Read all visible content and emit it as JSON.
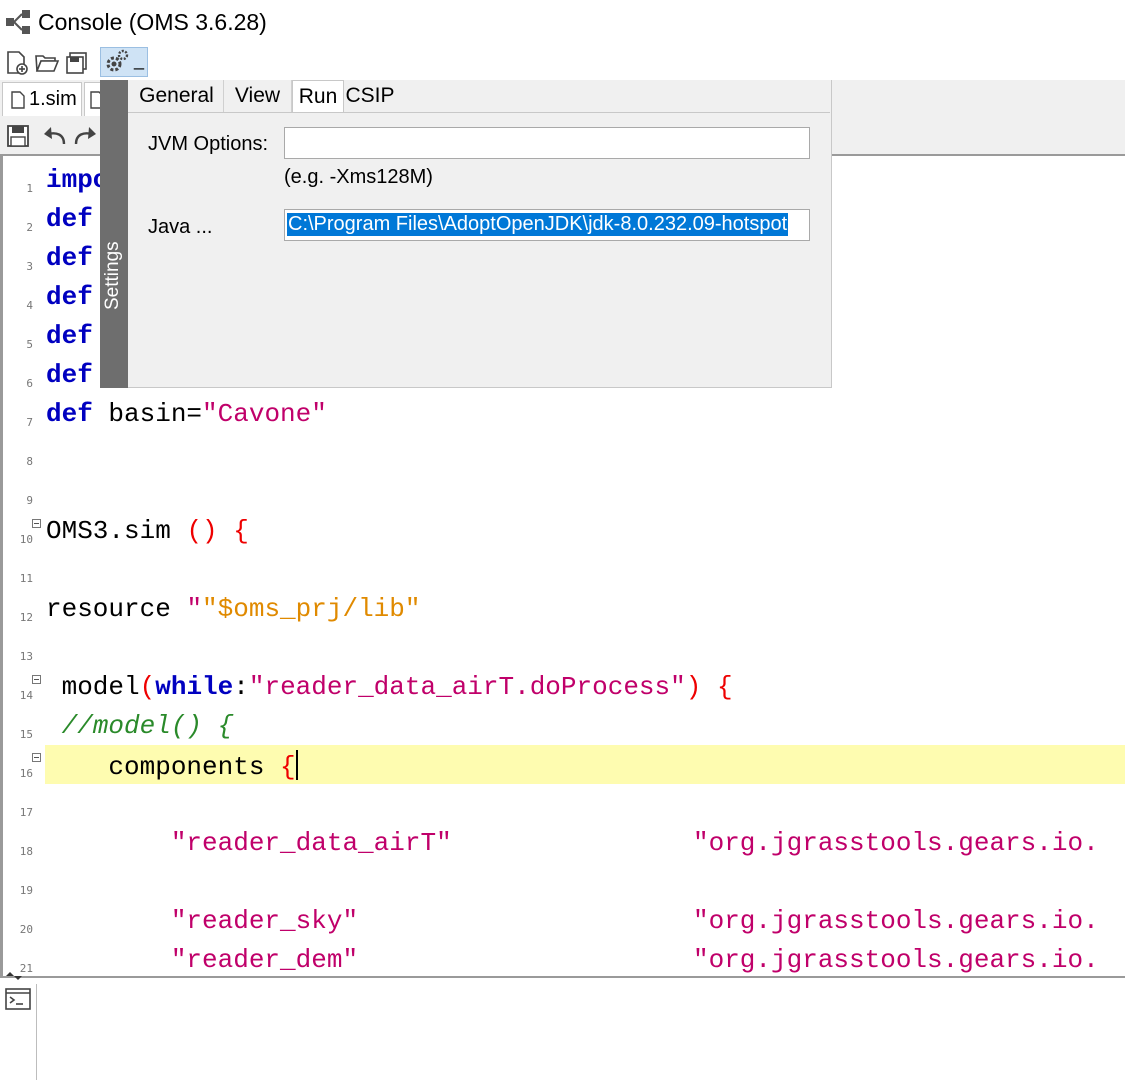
{
  "window": {
    "title": "Console (OMS 3.6.28)"
  },
  "toolbar": {
    "icons": [
      "new-file-icon",
      "open-folder-icon",
      "save-all-icon",
      "settings-gear-icon"
    ],
    "gear_suffix": "_"
  },
  "file_tabs": [
    {
      "label": "1.sim"
    },
    {
      "label": ""
    }
  ],
  "settings": {
    "side_label": "Settings",
    "tabs": [
      {
        "label": "General",
        "active": false
      },
      {
        "label": "View",
        "active": false
      },
      {
        "label": "Run",
        "active": true
      },
      {
        "label": "CSIP",
        "active": false
      }
    ],
    "jvm_label": "JVM Options:",
    "jvm_value": "",
    "jvm_hint": "(e.g. -Xms128M)",
    "java_label": "Java ...",
    "java_value": "C:\\Program Files\\AdoptOpenJDK\\jdk-8.0.232.09-hotspot"
  },
  "editor": {
    "line_numbers": [
      "1",
      "2",
      "3",
      "4",
      "5",
      "6",
      "7",
      "8",
      "9",
      "10",
      "11",
      "12",
      "13",
      "14",
      "15",
      "16",
      "17",
      "18",
      "19",
      "20",
      "21"
    ],
    "lines": {
      "l1": "impo",
      "def": "def",
      "l7_basin": "basin=",
      "l7_value": "\"Cavone\"",
      "l10_a": "OMS3.sim ",
      "l10_b": "()",
      "l10_c": "{",
      "l12_a": "resource ",
      "l12_b": "\"$oms_prj/lib\"",
      "l14_a": " model",
      "l14_b": "(",
      "l14_c": "while",
      "l14_d": ":",
      "l14_e": "\"reader_data_airT.doProcess\"",
      "l14_f": ")",
      "l14_g": "{",
      "l15": " //model() {",
      "l16_a": "    components ",
      "l16_b": "{",
      "l18_a": "        \"reader_data_airT\"",
      "l18_b": "\"org.jgrasstools.gears.io.",
      "l20_a": "        \"reader_sky\"",
      "l20_b": "\"org.jgrasstools.gears.io.",
      "l21_a": "        \"reader_dem\"",
      "l21_b": "\"org.jgrasstools.gears.io."
    }
  },
  "console": {
    "icon": "terminal-icon"
  }
}
